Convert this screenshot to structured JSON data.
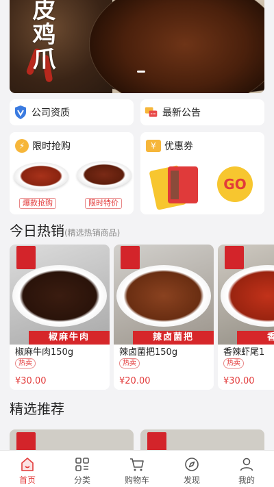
{
  "banner": {
    "title": "皮鸡爪"
  },
  "info": {
    "company_label": "公司资质",
    "notice_label": "最新公告"
  },
  "promos": {
    "flash_label": "限时抢购",
    "flash_tags": [
      "爆款抢购",
      "限时特价"
    ],
    "coupon_label": "优惠券",
    "coupon_go": "GO"
  },
  "hot": {
    "title": "今日热销",
    "subtitle": "(精选热销商品)",
    "items": [
      {
        "banner": "椒麻牛肉",
        "name": "椒麻牛肉150g",
        "tag": "热卖",
        "price": "¥30.00"
      },
      {
        "banner": "辣卤菌把",
        "name": "辣卤菌把150g",
        "tag": "热卖",
        "price": "¥20.00"
      },
      {
        "banner": "香辣",
        "name": "香辣虾尾1",
        "tag": "热卖",
        "price": "¥30.00"
      }
    ]
  },
  "recommend": {
    "title": "精选推荐"
  },
  "tabs": [
    {
      "label": "首页",
      "icon": "home-icon",
      "active": true
    },
    {
      "label": "分类",
      "icon": "category-icon",
      "active": false
    },
    {
      "label": "购物车",
      "icon": "cart-icon",
      "active": false
    },
    {
      "label": "发现",
      "icon": "compass-icon",
      "active": false
    },
    {
      "label": "我的",
      "icon": "user-icon",
      "active": false
    }
  ],
  "colors": {
    "accent": "#e23a3a",
    "coupon_yellow": "#f7c62f",
    "brand_red": "#d6272a"
  }
}
